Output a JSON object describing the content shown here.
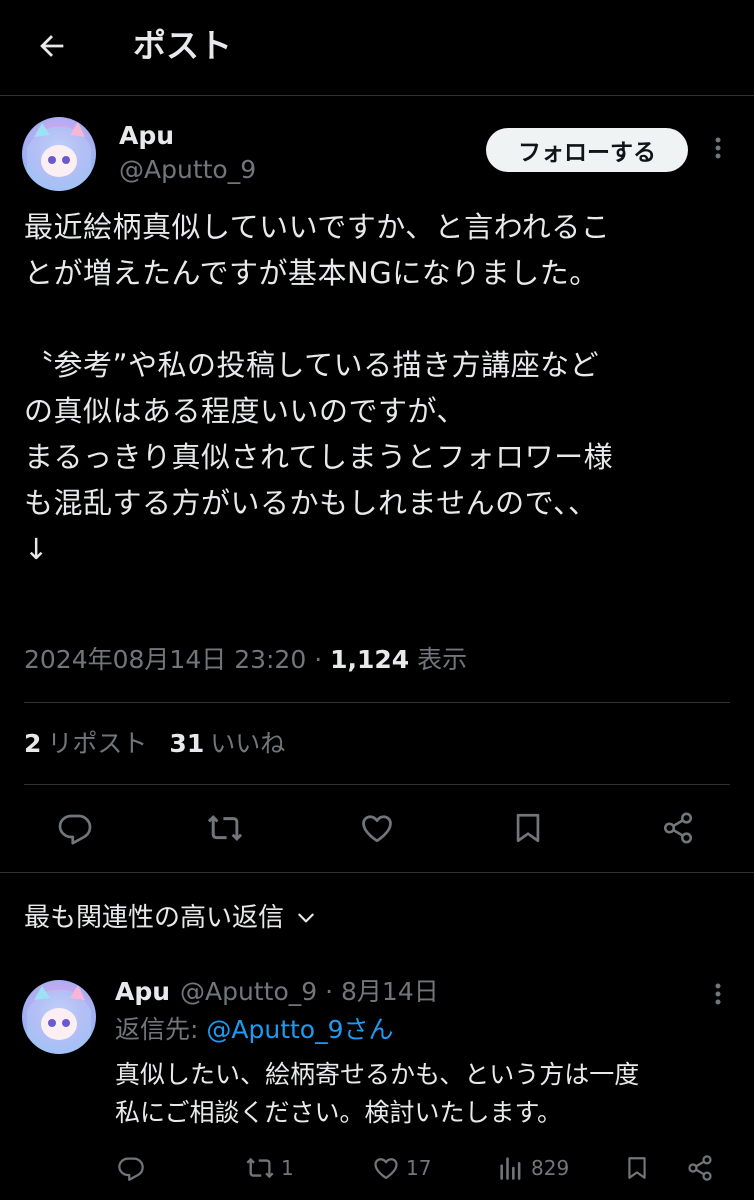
{
  "header": {
    "title": "ポスト",
    "back_icon": "arrow-left-icon"
  },
  "post": {
    "author_name": "Apu",
    "author_handle": "@Aputto_9",
    "follow_label": "フォローする",
    "text": "最近絵柄真似していいですか、と言われるこ\nとが増えたんですが基本NGになりました。\n\n〝参考”や私の投稿している描き方講座など\nの真似はある程度いいのですが、\nまるっきり真似されてしまうとフォロワー様\nも混乱する方がいるかもしれませんので、、\n↓",
    "timestamp": "2024年08月14日 23:20",
    "separator": " · ",
    "views_count": "1,124",
    "views_label": "表示",
    "reposts_count": "2",
    "reposts_label": "リポスト",
    "likes_count": "31",
    "likes_label": "いいね"
  },
  "actions": [
    "reply-icon",
    "repost-icon",
    "like-icon",
    "bookmark-icon",
    "share-icon"
  ],
  "replies_sort": {
    "label": "最も関連性の高い返信"
  },
  "reply": {
    "author_name": "Apu",
    "author_handle": "@Aputto_9",
    "date": "· 8月14日",
    "reply_to_prefix": "返信先: ",
    "reply_to_mention": "@Aputto_9さん",
    "text": "真似したい、絵柄寄せるかも、という方は一度\n私にご相談ください。検討いたします。",
    "reposts": "1",
    "likes": "17",
    "views": "829"
  },
  "colors": {
    "background": "#000000",
    "text": "#e7e9ea",
    "muted": "#71767b",
    "link": "#1d9bf0",
    "divider": "#2f3336"
  }
}
